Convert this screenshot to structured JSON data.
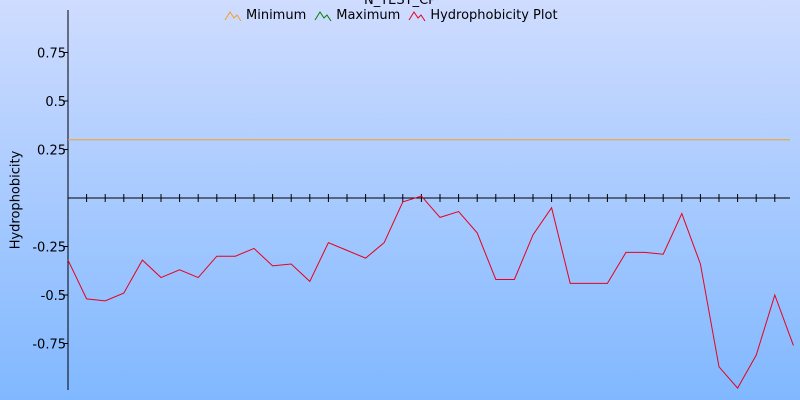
{
  "chart_data": {
    "type": "line",
    "title": "N_TEST_CP",
    "xlabel": "",
    "ylabel": "Hydrophobicity",
    "ylim": [
      -1.0,
      1.0
    ],
    "yticks": [
      0.75,
      0.5,
      0.25,
      -0.25,
      -0.5,
      -0.75
    ],
    "ytick_labels": [
      "0.75",
      "0.5",
      "0.25",
      "-0.25",
      "-0.5",
      "-0.75"
    ],
    "grid": false,
    "legend_position": "top",
    "background": {
      "top": "#cfdcff",
      "bottom": "#80b8ff"
    },
    "series": [
      {
        "name": "Minimum",
        "color": "#f4a020",
        "type": "hline",
        "value": 0.3
      },
      {
        "name": "Maximum",
        "color": "#008000",
        "type": "hline",
        "value": null
      },
      {
        "name": "Hydrophobicity Plot",
        "color": "#e8001c",
        "x": [
          1,
          2,
          3,
          4,
          5,
          6,
          7,
          8,
          9,
          10,
          11,
          12,
          13,
          14,
          15,
          16,
          17,
          18,
          19,
          20,
          21,
          22,
          23,
          24,
          25,
          26,
          27,
          28,
          29,
          30,
          31,
          32,
          33,
          34,
          35,
          36,
          37,
          38,
          39,
          40
        ],
        "values": [
          -0.32,
          -0.52,
          -0.53,
          -0.49,
          -0.32,
          -0.41,
          -0.37,
          -0.41,
          -0.3,
          -0.3,
          -0.26,
          -0.35,
          -0.34,
          -0.43,
          -0.23,
          -0.27,
          -0.31,
          -0.23,
          -0.02,
          0.01,
          -0.1,
          -0.07,
          -0.18,
          -0.42,
          -0.42,
          -0.19,
          -0.05,
          -0.44,
          -0.44,
          -0.44,
          -0.28,
          -0.28,
          -0.29,
          -0.08,
          -0.34,
          -0.87,
          -0.98,
          -0.81,
          -0.5,
          -0.76
        ]
      }
    ]
  }
}
